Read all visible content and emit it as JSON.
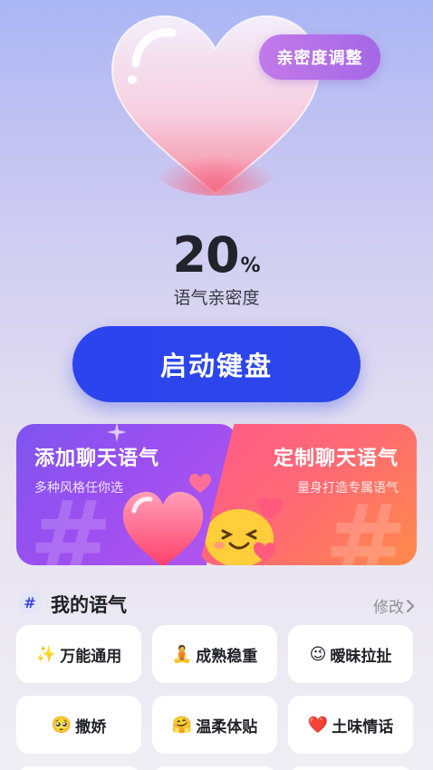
{
  "header": {
    "intimacy_adjust_label": "亲密度调整"
  },
  "intimacy": {
    "percent_value": "20",
    "percent_sign": "%",
    "label": "语气亲密度"
  },
  "start_button_label": "启动键盘",
  "cards": {
    "add": {
      "title": "添加聊天语气",
      "subtitle": "多种风格任你选"
    },
    "custom": {
      "title": "定制聊天语气",
      "subtitle": "量身打造专属语气"
    }
  },
  "my_tones": {
    "hash": "#",
    "title": "我的语气",
    "edit_label": "修改",
    "items": [
      {
        "emoji": "✨",
        "label": "万能通用"
      },
      {
        "emoji": "🧘",
        "label": "成熟稳重"
      },
      {
        "emoji": "😉",
        "label": "暧昧拉扯"
      },
      {
        "emoji": "🥺",
        "label": "撒娇"
      },
      {
        "emoji": "🤗",
        "label": "温柔体贴"
      },
      {
        "emoji": "❤️",
        "label": "土味情话"
      }
    ]
  },
  "colors": {
    "primary_blue": "#2c44ef",
    "purple_pill": "#b06fe8",
    "card_purple": "#8f52f0",
    "card_pink": "#ff6278"
  }
}
